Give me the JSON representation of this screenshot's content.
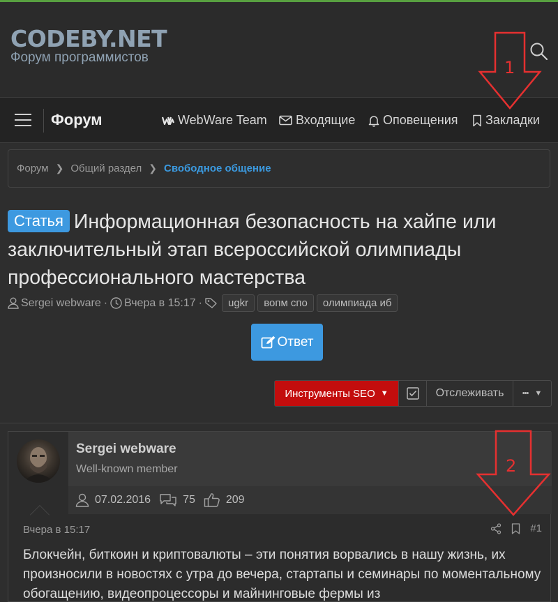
{
  "header": {
    "logo_title": "CODEBY.NET",
    "logo_subtitle": "Форум программистов",
    "search_icon": "search-icon"
  },
  "navbar": {
    "menu_icon": "hamburger-icon",
    "forum_label": "Форум",
    "links": [
      {
        "label": "WebWare Team",
        "icon": "ww-logo-icon"
      },
      {
        "label": "Входящие",
        "icon": "envelope-icon"
      },
      {
        "label": "Оповещения",
        "icon": "bell-icon"
      },
      {
        "label": "Закладки",
        "icon": "bookmark-icon"
      }
    ]
  },
  "breadcrumb": [
    "Форум",
    "Общий раздел",
    "Свободное общение"
  ],
  "thread": {
    "prefix": "Статья",
    "title": "Информационная безопасность на хайпе или заключительный этап всероссийской олимпиады профессионального мастерства",
    "author": "Sergei webware",
    "date": "Вчера в 15:17",
    "tags": [
      "ugkr",
      "вопм спо",
      "олимпиада иб"
    ]
  },
  "buttons": {
    "reply": "Ответ",
    "seo_tools": "Инструменты SEO",
    "follow": "Отслеживать",
    "more": "•••"
  },
  "post": {
    "author": "Sergei webware",
    "user_title": "Well-known member",
    "joined": "07.02.2016",
    "messages": "75",
    "reactions": "209",
    "date": "Вчера в 15:17",
    "number": "#1",
    "body": "Блокчейн, биткоин и криптовалюты – эти понятия ворвались в нашу жизнь, их произносили в новостях с утра до вечера, стартапы и семинары по моментальному обогащению, видеопроцессоры и майнинговые фермы из"
  },
  "annotations": [
    {
      "label": "1",
      "color": "#e53030"
    },
    {
      "label": "2",
      "color": "#e53030"
    }
  ]
}
